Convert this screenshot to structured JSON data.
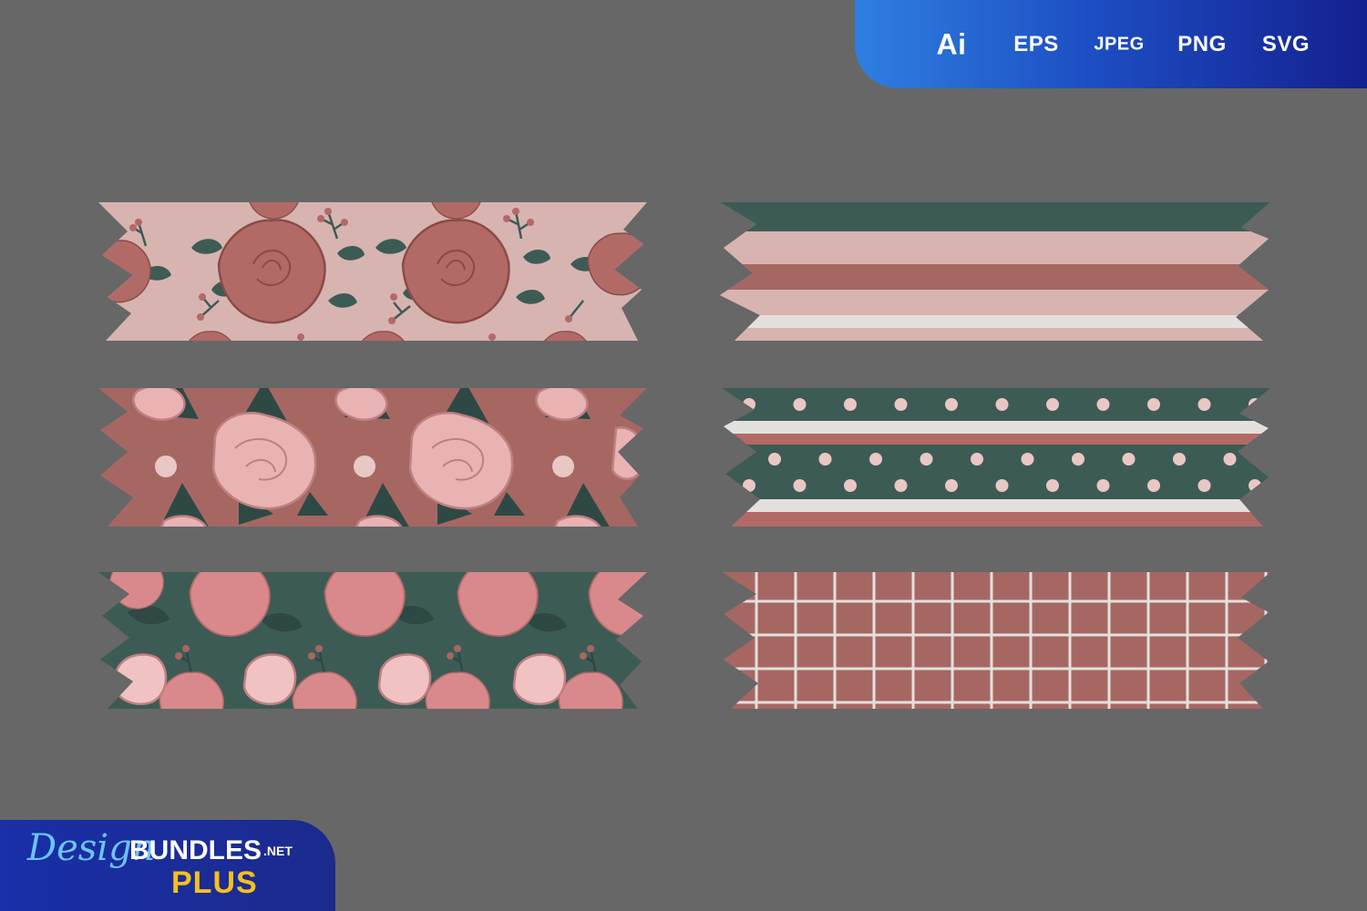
{
  "formats": [
    "Ai",
    "EPS",
    "JPEG",
    "PNG",
    "SVG"
  ],
  "brand": {
    "script_part": "Design",
    "bold_part": "BUNDLES",
    "suffix": ".NET",
    "tier": "PLUS"
  },
  "colors": {
    "background": "#676767",
    "blush": "#d7b4b0",
    "mauve": "#a66763",
    "rose": "#b26a67",
    "dark_rose": "#8a4a48",
    "pink_petal": "#e9b3b3",
    "pink_petal_line": "#c07f81",
    "forest": "#3d5b55",
    "forest_dark": "#2e4944",
    "off_white": "#e4e0de"
  },
  "tapes": [
    {
      "pattern": "rose-floral-on-blush",
      "column": "left",
      "row": 1
    },
    {
      "pattern": "horizontal-stripes",
      "column": "right",
      "row": 1
    },
    {
      "pattern": "peony-floral-on-mauve",
      "column": "left",
      "row": 2
    },
    {
      "pattern": "polka-dot-stripes",
      "column": "right",
      "row": 2
    },
    {
      "pattern": "pink-floral-on-forest",
      "column": "left",
      "row": 3
    },
    {
      "pattern": "grid-on-mauve",
      "column": "right",
      "row": 3
    }
  ]
}
